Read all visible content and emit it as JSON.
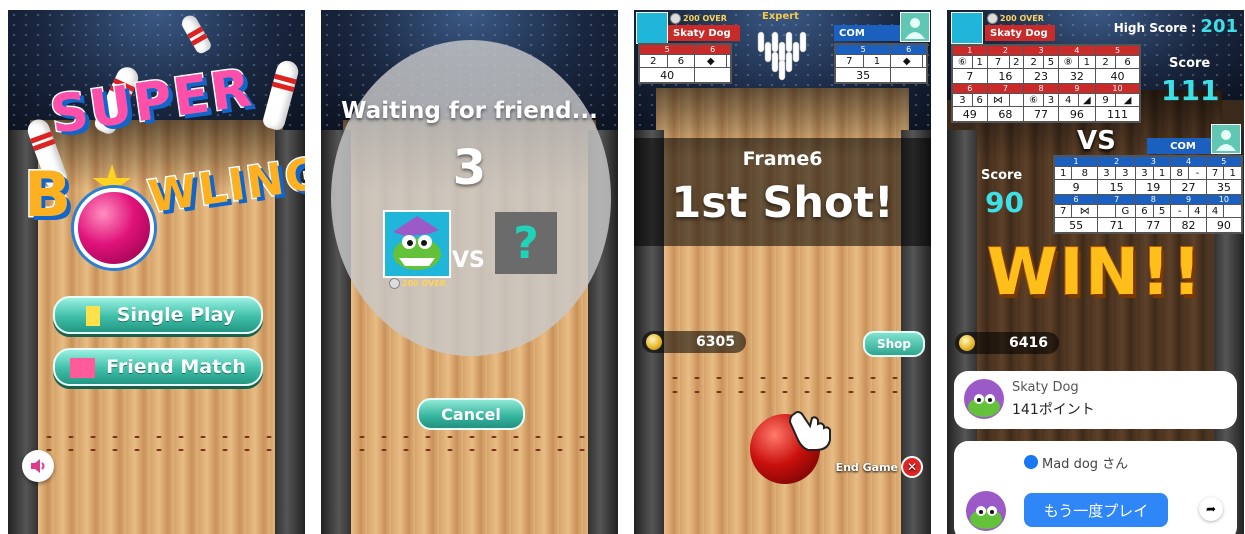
{
  "screen1": {
    "logo_line1": "SUPER",
    "logo_line2_a": "B",
    "logo_line2_b": "WLING",
    "single_play_label": "Single Play",
    "friend_match_label": "Friend Match",
    "icons": {
      "single": "person-icon",
      "friend": "two-people-icon",
      "sound": "speaker-icon"
    },
    "colors": {
      "button": "#3fbfa8",
      "single_icon": "#ffe14a",
      "friend_icon": "#ff5a9a"
    }
  },
  "screen2": {
    "title": "Waiting for friend...",
    "countdown": "3",
    "vs_label": "VS",
    "unknown_opponent": "?",
    "player_badge": "200 OVER",
    "cancel_label": "Cancel"
  },
  "screen3": {
    "difficulty": "Expert",
    "player_badge": "200 OVER",
    "player_name": "Skaty Dog",
    "player_frames": [
      "5",
      "6"
    ],
    "player_rolls": [
      "2",
      "6",
      "◆",
      ""
    ],
    "player_totals": [
      "40",
      ""
    ],
    "com_name": "COM",
    "com_frames": [
      "5",
      "6"
    ],
    "com_rolls": [
      "7",
      "1",
      "◆",
      ""
    ],
    "com_totals": [
      "35",
      ""
    ],
    "frame_label": "Frame6",
    "shot_label": "1st Shot!",
    "coins": "6305",
    "shop_label": "Shop",
    "end_game_label": "End Game"
  },
  "screen4": {
    "player_badge": "200 OVER",
    "player_name": "Skaty Dog",
    "high_score_label": "High Score :",
    "high_score": "201",
    "score_label": "Score",
    "player_score": "111",
    "vs_label": "VS",
    "com_name": "COM",
    "com_score_label": "Score",
    "com_score": "90",
    "player_card": {
      "frames": [
        "1",
        "2",
        "3",
        "4",
        "5",
        "6",
        "7",
        "8",
        "9",
        "10"
      ],
      "rolls": [
        "⑥",
        "1",
        "7",
        "2",
        "2",
        "5",
        "⑧",
        "1",
        "2",
        "6",
        "3",
        "6",
        "⋈",
        "",
        "⑥",
        "3",
        "4",
        "◢",
        "9",
        "◢"
      ],
      "totals": [
        "7",
        "16",
        "23",
        "32",
        "40",
        "49",
        "68",
        "77",
        "96",
        "111"
      ]
    },
    "com_card": {
      "frames": [
        "1",
        "2",
        "3",
        "4",
        "5",
        "6",
        "7",
        "8",
        "9",
        "10"
      ],
      "rolls": [
        "1",
        "8",
        "3",
        "3",
        "3",
        "1",
        "8",
        "-",
        "7",
        "1",
        "7",
        "⋈",
        "",
        "G",
        "6",
        "5",
        "-",
        "4",
        "4",
        ""
      ],
      "totals": [
        "9",
        "15",
        "19",
        "27",
        "35",
        "55",
        "71",
        "77",
        "82",
        "90"
      ]
    },
    "win_label": "WIN!!",
    "coins": "6416",
    "result_card": {
      "name": "Skaty Dog",
      "points": "141ポイント"
    },
    "message_card": {
      "sender": "Mad dog  さん",
      "replay_label": "もう一度プレイ"
    }
  }
}
